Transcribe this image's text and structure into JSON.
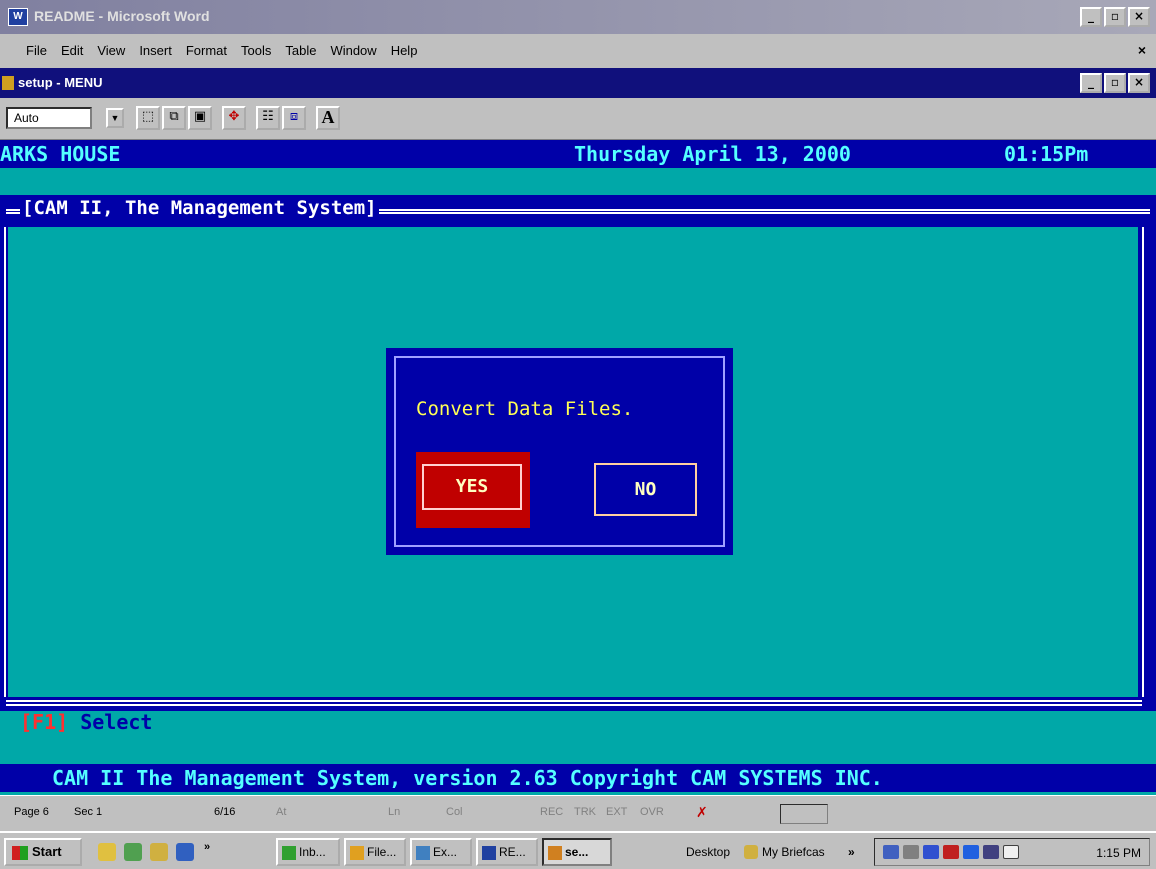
{
  "word_window": {
    "title": "README - Microsoft Word",
    "minimize": "_",
    "maximize": "▫",
    "close": "×",
    "menu": [
      "File",
      "Edit",
      "View",
      "Insert",
      "Format",
      "Tools",
      "Table",
      "Window",
      "Help"
    ],
    "menu_close": "×"
  },
  "setup_window": {
    "title": "setup - MENU"
  },
  "toolbar": {
    "font_size_value": "Auto",
    "dropdown_arrow": "▼",
    "font_button": "A"
  },
  "console": {
    "header_left": "ARKS HOUSE",
    "header_date": "Thursday April 13, 2000",
    "header_time": "01:15Pm",
    "frame_title": "[CAM II, The Management System]",
    "f1_key": "[F1]",
    "f1_label": " Select",
    "footer": "CAM II The Management System, version 2.63  Copyright CAM SYSTEMS INC."
  },
  "dialog": {
    "message": "Convert Data Files.",
    "yes_label": "YES",
    "no_label": "NO"
  },
  "statusbar": {
    "page": "Page 6",
    "sec": "Sec 1",
    "pages": "6/16",
    "at": "At",
    "ln": "Ln",
    "col": "Col",
    "rec": "REC",
    "trk": "TRK",
    "ext": "EXT",
    "ovr": "OVR"
  },
  "taskbar": {
    "start": "Start",
    "more": "»",
    "tasks": [
      "Inb...",
      "File...",
      "Ex...",
      "RE...",
      "se..."
    ],
    "desktop": "Desktop",
    "briefcase": "My Briefcas",
    "more2": "»",
    "clock": "1:15 PM"
  },
  "colors": {
    "dos_blue": "#0000a8",
    "dos_cyan": "#00a8a8",
    "yes_red": "#c00000"
  }
}
